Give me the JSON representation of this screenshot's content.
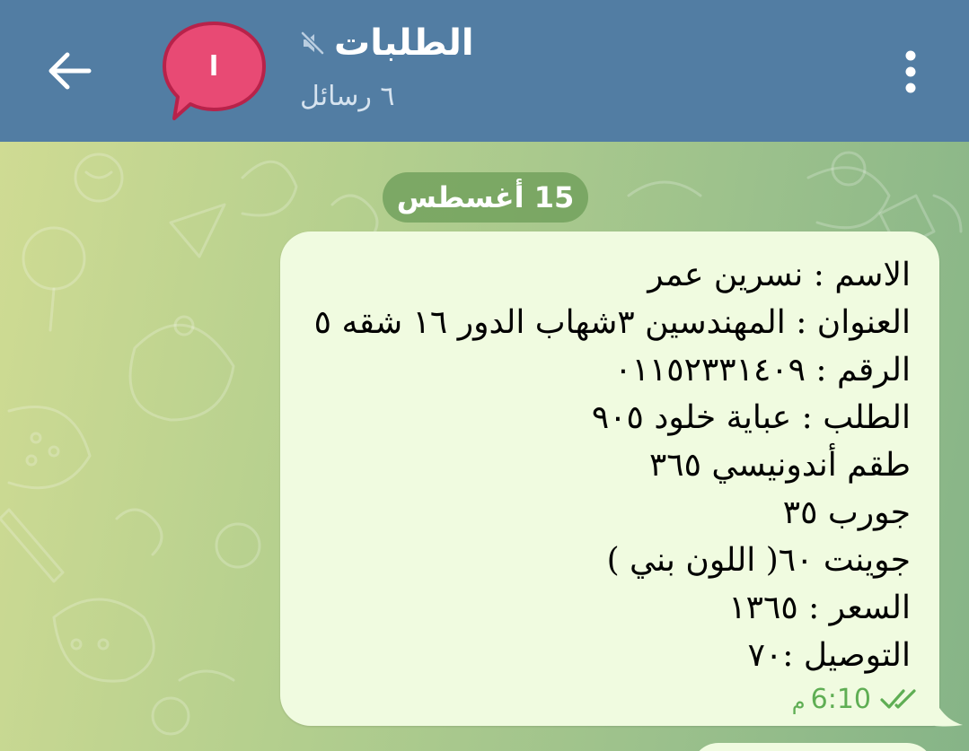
{
  "header": {
    "back_icon": "arrow-left-icon",
    "avatar_letter": "ا",
    "avatar_color": "#e84a74",
    "title": "الطلبات",
    "muted_icon": "speaker-muted-icon",
    "subtitle": "٦ رسائل",
    "menu_icon": "more-vertical-icon",
    "background": "#527da3"
  },
  "chat": {
    "date_label": "15 أغسطس",
    "message": {
      "lines": [
        "الاسم : نسرين عمر",
        "العنوان : المهندسين ٣شهاب الدور ١٦ شقه ٥",
        "الرقم : ٠١١٥٢٣٣١٤٠٩",
        "الطلب : عباية خلود ٩٠٥",
        "طقم أندونيسي ٣٦٥",
        "جورب ٣٥",
        "جوينت ٦٠( اللون بني )",
        "السعر :  ١٣٦٥",
        "التوصيل :٧٠"
      ],
      "time": "6:10",
      "time_suffix": "م",
      "status_icon": "double-check-icon",
      "bubble_color": "#f0fbe0",
      "meta_color": "#5fae54"
    }
  }
}
